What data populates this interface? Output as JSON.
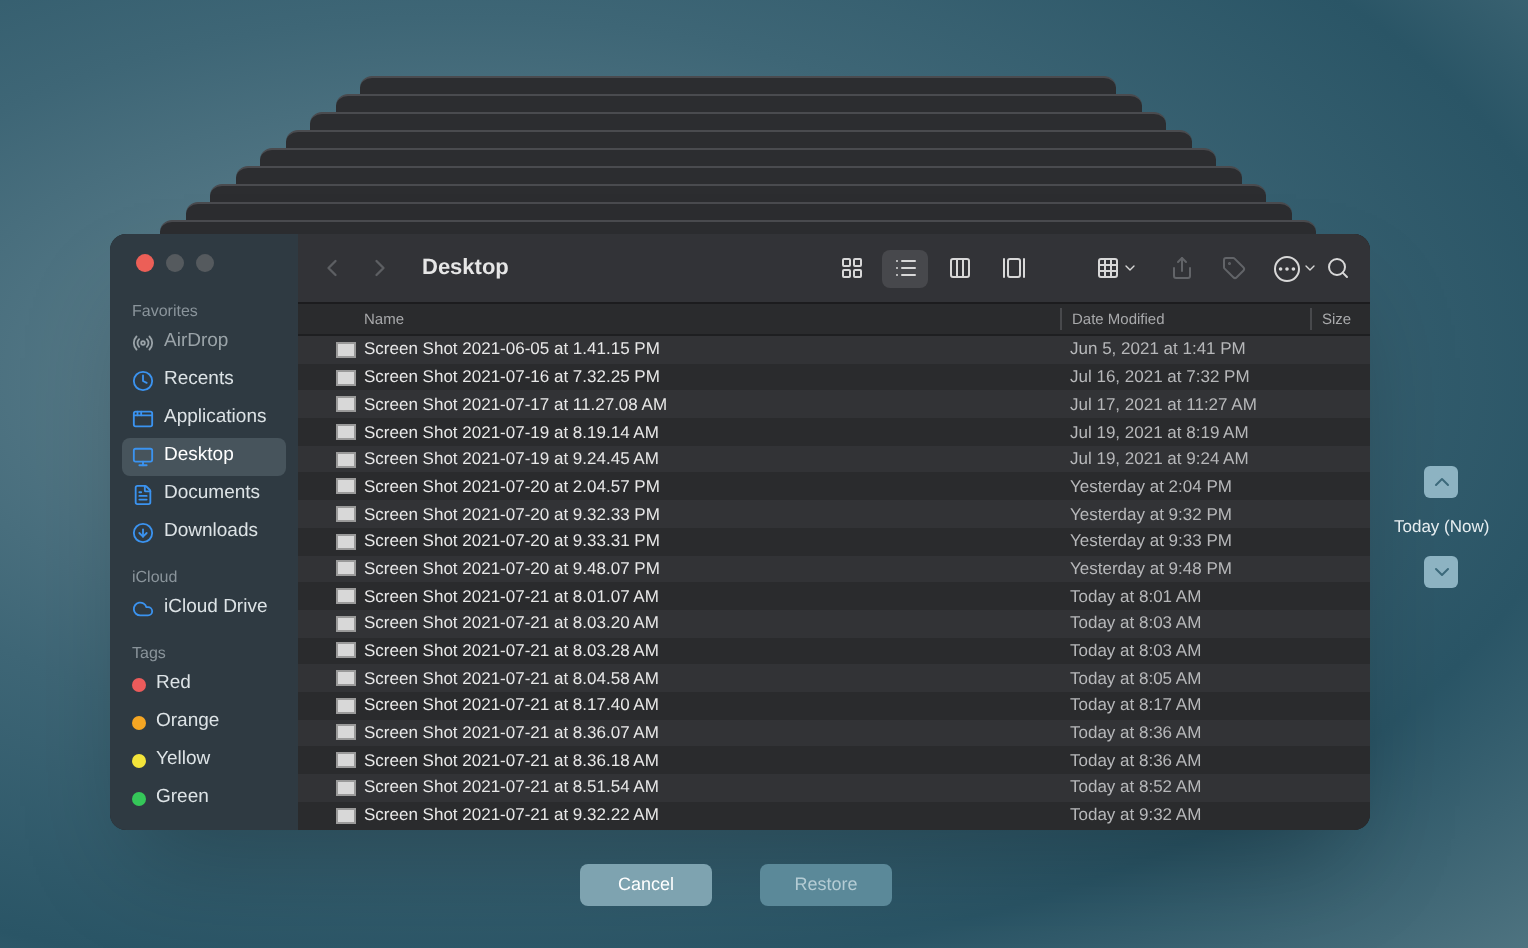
{
  "window": {
    "title": "Desktop"
  },
  "sidebar": {
    "sections": [
      {
        "title": "Favorites",
        "items": [
          {
            "label": "AirDrop",
            "selected": false
          },
          {
            "label": "Recents",
            "selected": false
          },
          {
            "label": "Applications",
            "selected": false
          },
          {
            "label": "Desktop",
            "selected": true
          },
          {
            "label": "Documents",
            "selected": false
          },
          {
            "label": "Downloads",
            "selected": false
          }
        ]
      },
      {
        "title": "iCloud",
        "items": [
          {
            "label": "iCloud Drive",
            "selected": false
          }
        ]
      },
      {
        "title": "Tags",
        "items": [
          {
            "label": "Red",
            "color": "#ec5b5b",
            "selected": false
          },
          {
            "label": "Orange",
            "color": "#f5a623",
            "selected": false
          },
          {
            "label": "Yellow",
            "color": "#f3e43a",
            "selected": false
          },
          {
            "label": "Green",
            "color": "#35c759",
            "selected": false
          }
        ]
      }
    ]
  },
  "toolbar": {
    "view_buttons": [
      {
        "selected": false
      },
      {
        "selected": true
      },
      {
        "selected": false
      },
      {
        "selected": false
      }
    ]
  },
  "table": {
    "columns": [
      "Name",
      "Date Modified",
      "Size"
    ],
    "rows": [
      {
        "name": "Screen Shot 2021-06-05 at 1.41.15 PM",
        "date": "Jun 5, 2021 at 1:41 PM"
      },
      {
        "name": "Screen Shot 2021-07-16 at 7.32.25 PM",
        "date": "Jul 16, 2021 at 7:32 PM"
      },
      {
        "name": "Screen Shot 2021-07-17 at 11.27.08 AM",
        "date": "Jul 17, 2021 at 11:27 AM"
      },
      {
        "name": "Screen Shot 2021-07-19 at 8.19.14 AM",
        "date": "Jul 19, 2021 at 8:19 AM"
      },
      {
        "name": "Screen Shot 2021-07-19 at 9.24.45 AM",
        "date": "Jul 19, 2021 at 9:24 AM"
      },
      {
        "name": "Screen Shot 2021-07-20 at 2.04.57 PM",
        "date": "Yesterday at 2:04 PM"
      },
      {
        "name": "Screen Shot 2021-07-20 at 9.32.33 PM",
        "date": "Yesterday at 9:32 PM"
      },
      {
        "name": "Screen Shot 2021-07-20 at 9.33.31 PM",
        "date": "Yesterday at 9:33 PM"
      },
      {
        "name": "Screen Shot 2021-07-20 at 9.48.07 PM",
        "date": "Yesterday at 9:48 PM"
      },
      {
        "name": "Screen Shot 2021-07-21 at 8.01.07 AM",
        "date": "Today at 8:01 AM"
      },
      {
        "name": "Screen Shot 2021-07-21 at 8.03.20 AM",
        "date": "Today at 8:03 AM"
      },
      {
        "name": "Screen Shot 2021-07-21 at 8.03.28 AM",
        "date": "Today at 8:03 AM"
      },
      {
        "name": "Screen Shot 2021-07-21 at 8.04.58 AM",
        "date": "Today at 8:05 AM"
      },
      {
        "name": "Screen Shot 2021-07-21 at 8.17.40 AM",
        "date": "Today at 8:17 AM"
      },
      {
        "name": "Screen Shot 2021-07-21 at 8.36.07 AM",
        "date": "Today at 8:36 AM"
      },
      {
        "name": "Screen Shot 2021-07-21 at 8.36.18 AM",
        "date": "Today at 8:36 AM"
      },
      {
        "name": "Screen Shot 2021-07-21 at 8.51.54 AM",
        "date": "Today at 8:52 AM"
      },
      {
        "name": "Screen Shot 2021-07-21 at 9.32.22 AM",
        "date": "Today at 9:32 AM"
      }
    ]
  },
  "timeline": {
    "label": "Today (Now)"
  },
  "buttons": [
    {
      "label": "Cancel",
      "disabled": false
    },
    {
      "label": "Restore",
      "disabled": true
    }
  ]
}
